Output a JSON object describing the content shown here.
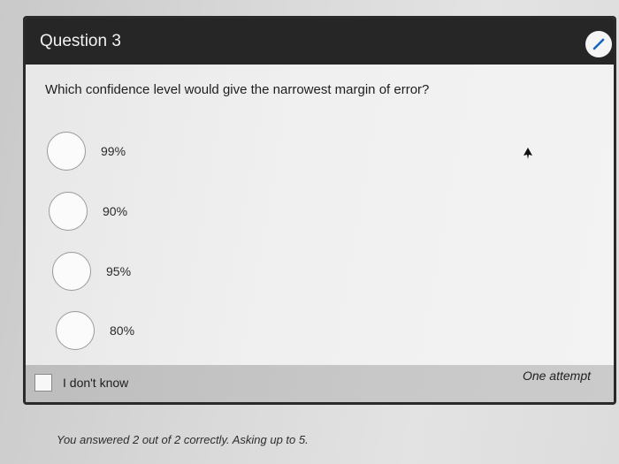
{
  "question": {
    "title": "Question 3",
    "text": "Which confidence level would give the narrowest margin of error?",
    "options": [
      {
        "label": "99%"
      },
      {
        "label": "90%"
      },
      {
        "label": "95%"
      },
      {
        "label": "80%"
      }
    ],
    "dont_know_label": "I don't know",
    "attempt_label": "One attempt"
  },
  "status": {
    "text": "You answered 2 out of 2 correctly. Asking up to 5."
  },
  "colors": {
    "header_bg": "#262626",
    "header_text": "#f2f2f2",
    "edit_icon": "#1565c0"
  },
  "icons": {
    "edit": "pencil-icon",
    "cursor": "mouse-pointer-icon"
  }
}
